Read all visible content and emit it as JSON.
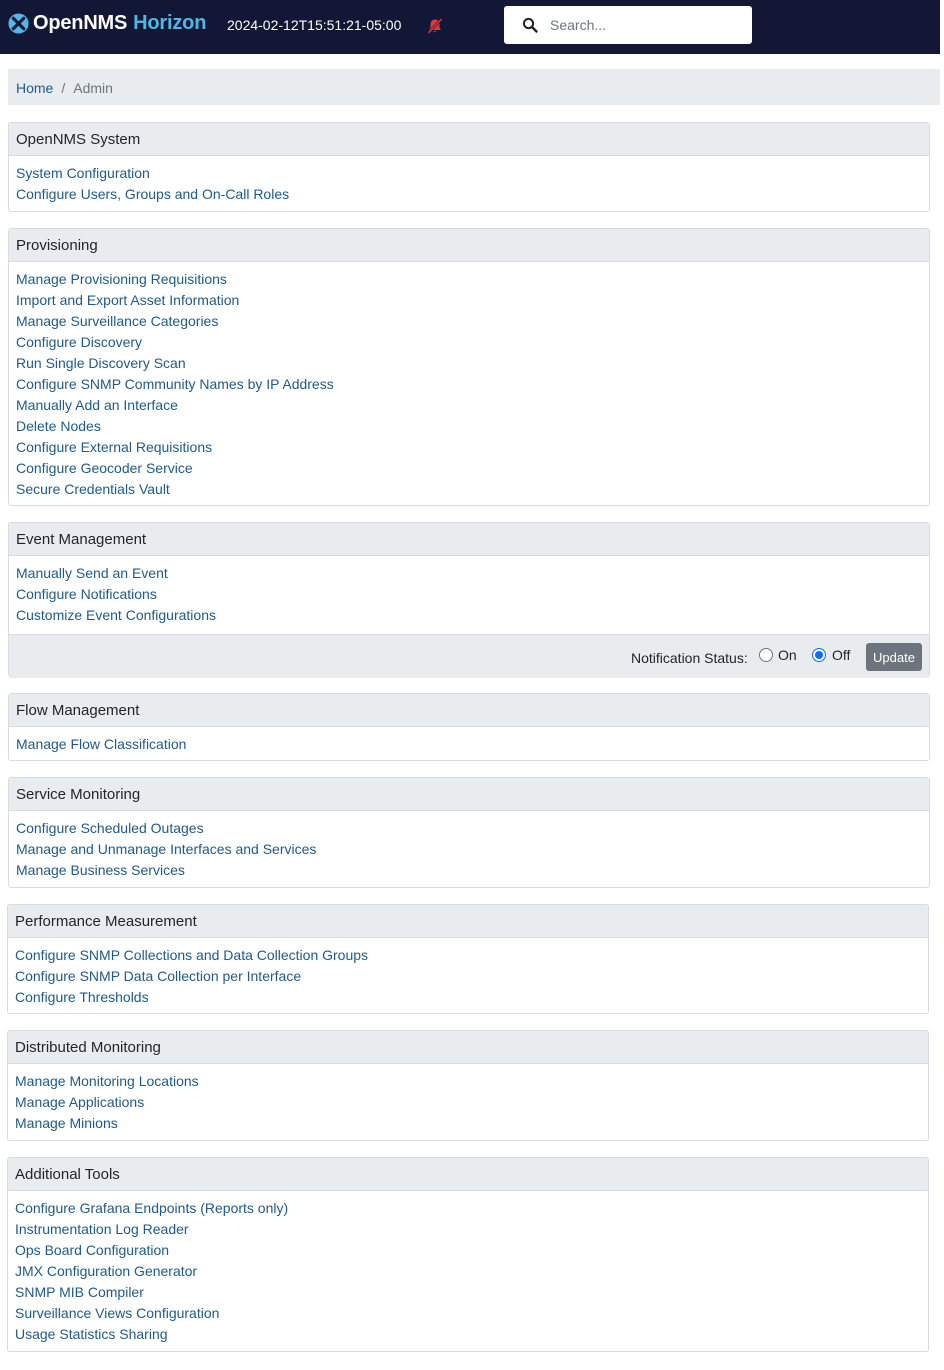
{
  "navbar": {
    "brand_open": "OpenNMS",
    "brand_horizon": "Horizon",
    "datetime": "2024-02-12T15:51:21-05:00",
    "alarm_icon": "notifications-off-icon",
    "search_placeholder": "Search...",
    "colors": {
      "background": "#131736",
      "brand_accent": "#4fb8e6",
      "alarm": "#e03a3e"
    }
  },
  "breadcrumb": {
    "home": "Home",
    "separator": "/",
    "current": "Admin"
  },
  "sections": {
    "opennms_system": {
      "title": "OpenNMS System",
      "links": [
        "System Configuration",
        "Configure Users, Groups and On-Call Roles"
      ]
    },
    "provisioning": {
      "title": "Provisioning",
      "links": [
        "Manage Provisioning Requisitions",
        "Import and Export Asset Information",
        "Manage Surveillance Categories",
        "Configure Discovery",
        "Run Single Discovery Scan",
        "Configure SNMP Community Names by IP Address",
        "Manually Add an Interface",
        "Delete Nodes",
        "Configure External Requisitions",
        "Configure Geocoder Service",
        "Secure Credentials Vault"
      ]
    },
    "event_management": {
      "title": "Event Management",
      "links": [
        "Manually Send an Event",
        "Configure Notifications",
        "Customize Event Configurations"
      ],
      "notification_status_label": "Notification Status:",
      "option_on": "On",
      "option_off": "Off",
      "selected": "Off",
      "update_label": "Update"
    },
    "flow_management": {
      "title": "Flow Management",
      "links": [
        "Manage Flow Classification"
      ]
    },
    "service_monitoring": {
      "title": "Service Monitoring",
      "links": [
        "Configure Scheduled Outages",
        "Manage and Unmanage Interfaces and Services",
        "Manage Business Services"
      ]
    },
    "performance_measurement": {
      "title": "Performance Measurement",
      "links": [
        "Configure SNMP Collections and Data Collection Groups",
        "Configure SNMP Data Collection per Interface",
        "Configure Thresholds"
      ]
    },
    "distributed_monitoring": {
      "title": "Distributed Monitoring",
      "links": [
        "Manage Monitoring Locations",
        "Manage Applications",
        "Manage Minions"
      ]
    },
    "additional_tools": {
      "title": "Additional Tools",
      "links": [
        "Configure Grafana Endpoints (Reports only)",
        "Instrumentation Log Reader",
        "Ops Board Configuration",
        "JMX Configuration Generator",
        "SNMP MIB Compiler",
        "Surveillance Views Configuration",
        "Usage Statistics Sharing"
      ]
    }
  }
}
